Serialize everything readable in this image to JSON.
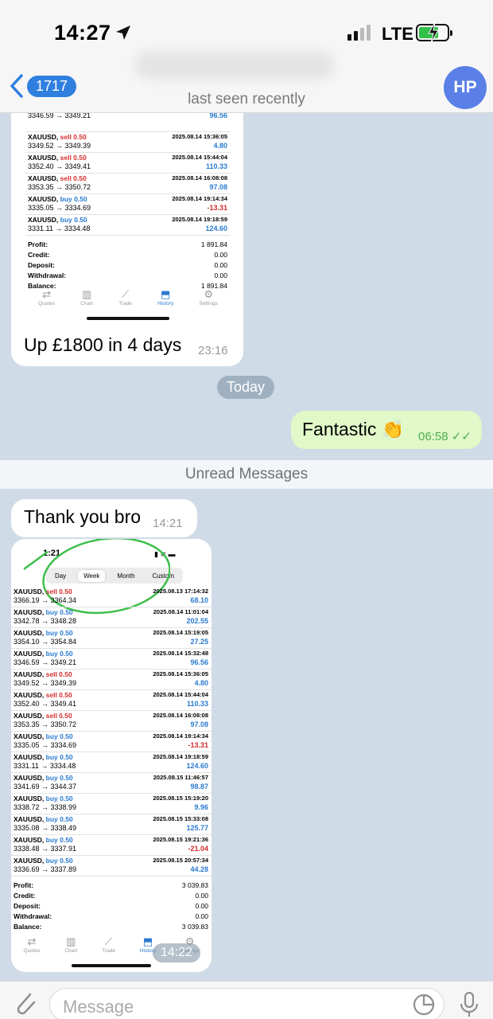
{
  "status_bar": {
    "time": "14:27",
    "network": "LTE"
  },
  "header": {
    "back_count": "1717",
    "subtitle": "last seen recently",
    "avatar_initials": "HP"
  },
  "screenshot1": {
    "rows": [
      {
        "sym": "",
        "dir": "",
        "type": "",
        "date": "",
        "prices": "3346.59 → 3349.21",
        "pl": "96.56",
        "sign": "pos"
      },
      {
        "sym": "XAUUSD,",
        "dir": "sell 0.50",
        "type": "sell",
        "date": "2025.08.14 15:36:05",
        "prices": "3349.52 → 3349.39",
        "pl": "4.80",
        "sign": "pos"
      },
      {
        "sym": "XAUUSD,",
        "dir": "sell 0.50",
        "type": "sell",
        "date": "2025.08.14 15:44:04",
        "prices": "3352.40 → 3349.41",
        "pl": "110.33",
        "sign": "pos"
      },
      {
        "sym": "XAUUSD,",
        "dir": "sell 0.50",
        "type": "sell",
        "date": "2025.08.14 16:08:08",
        "prices": "3353.35 → 3350.72",
        "pl": "97.08",
        "sign": "pos"
      },
      {
        "sym": "XAUUSD,",
        "dir": "buy 0.50",
        "type": "buy",
        "date": "2025.08.14 19:14:34",
        "prices": "3335.05 → 3334.69",
        "pl": "-13.31",
        "sign": "neg"
      },
      {
        "sym": "XAUUSD,",
        "dir": "buy 0.50",
        "type": "buy",
        "date": "2025.08.14 19:18:59",
        "prices": "3331.11 → 3334.48",
        "pl": "124.60",
        "sign": "pos"
      }
    ],
    "summary": [
      {
        "label": "Profit:",
        "value": "1 891.84"
      },
      {
        "label": "Credit:",
        "value": "0.00"
      },
      {
        "label": "Deposit:",
        "value": "0.00"
      },
      {
        "label": "Withdrawal:",
        "value": "0.00"
      },
      {
        "label": "Balance:",
        "value": "1 891.84"
      }
    ],
    "tabs": [
      "Quotes",
      "Chart",
      "Trade",
      "History",
      "Settings"
    ]
  },
  "messages": {
    "m1": {
      "text": "Up £1800 in 4 days",
      "time": "23:16"
    },
    "date_pill": "Today",
    "m2": {
      "text": "Fantastic 👏",
      "time": "06:58"
    },
    "unread": "Unread Messages",
    "m3": {
      "text": "Thank you bro",
      "time": "14:21"
    },
    "m4_time": "14:22"
  },
  "screenshot2": {
    "status_time": "1:21",
    "segments": [
      "Day",
      "Week",
      "Month",
      "Custom"
    ],
    "selected_segment": "Week",
    "rows": [
      {
        "sym": "XAUUSD,",
        "dir": "sell 0.50",
        "type": "sell",
        "date": "2025.08.13 17:14:32",
        "prices": "3366.19 → 3364.34",
        "pl": "68.10",
        "sign": "pos"
      },
      {
        "sym": "XAUUSD,",
        "dir": "buy 0.50",
        "type": "buy",
        "date": "2025.08.14 11:01:04",
        "prices": "3342.78 → 3348.28",
        "pl": "202.55",
        "sign": "pos"
      },
      {
        "sym": "XAUUSD,",
        "dir": "buy 0.50",
        "type": "buy",
        "date": "2025.08.14 15:19:05",
        "prices": "3354.10 → 3354.84",
        "pl": "27.25",
        "sign": "pos"
      },
      {
        "sym": "XAUUSD,",
        "dir": "buy 0.50",
        "type": "buy",
        "date": "2025.08.14 15:32:48",
        "prices": "3346.59 → 3349.21",
        "pl": "96.56",
        "sign": "pos"
      },
      {
        "sym": "XAUUSD,",
        "dir": "sell 0.50",
        "type": "sell",
        "date": "2025.08.14 15:36:05",
        "prices": "3349.52 → 3349.39",
        "pl": "4.80",
        "sign": "pos"
      },
      {
        "sym": "XAUUSD,",
        "dir": "sell 0.50",
        "type": "sell",
        "date": "2025.08.14 15:44:04",
        "prices": "3352.40 → 3349.41",
        "pl": "110.33",
        "sign": "pos"
      },
      {
        "sym": "XAUUSD,",
        "dir": "sell 0.50",
        "type": "sell",
        "date": "2025.08.14 16:08:08",
        "prices": "3353.35 → 3350.72",
        "pl": "97.08",
        "sign": "pos"
      },
      {
        "sym": "XAUUSD,",
        "dir": "buy 0.50",
        "type": "buy",
        "date": "2025.08.14 19:14:34",
        "prices": "3335.05 → 3334.69",
        "pl": "-13.31",
        "sign": "neg"
      },
      {
        "sym": "XAUUSD,",
        "dir": "buy 0.50",
        "type": "buy",
        "date": "2025.08.14 19:18:59",
        "prices": "3331.11 → 3334.48",
        "pl": "124.60",
        "sign": "pos"
      },
      {
        "sym": "XAUUSD,",
        "dir": "buy 0.50",
        "type": "buy",
        "date": "2025.08.15 11:46:57",
        "prices": "3341.69 → 3344.37",
        "pl": "98.87",
        "sign": "pos"
      },
      {
        "sym": "XAUUSD,",
        "dir": "buy 0.50",
        "type": "buy",
        "date": "2025.08.15 15:19:20",
        "prices": "3338.72 → 3338.99",
        "pl": "9.96",
        "sign": "pos"
      },
      {
        "sym": "XAUUSD,",
        "dir": "buy 0.50",
        "type": "buy",
        "date": "2025.08.15 15:33:08",
        "prices": "3335.08 → 3338.49",
        "pl": "125.77",
        "sign": "pos"
      },
      {
        "sym": "XAUUSD,",
        "dir": "buy 0.50",
        "type": "buy",
        "date": "2025.08.15 19:21:36",
        "prices": "3338.48 → 3337.91",
        "pl": "-21.04",
        "sign": "neg"
      },
      {
        "sym": "XAUUSD,",
        "dir": "buy 0.50",
        "type": "buy",
        "date": "2025.08.15 20:57:34",
        "prices": "3336.69 → 3337.89",
        "pl": "44.28",
        "sign": "pos"
      }
    ],
    "summary": [
      {
        "label": "Profit:",
        "value": "3 039.83"
      },
      {
        "label": "Credit:",
        "value": "0.00"
      },
      {
        "label": "Deposit:",
        "value": "0.00"
      },
      {
        "label": "Withdrawal:",
        "value": "0.00"
      },
      {
        "label": "Balance:",
        "value": "3 039.83"
      }
    ],
    "tabs": [
      "Quotes",
      "Chart",
      "Trade",
      "History",
      "Settings"
    ]
  },
  "input": {
    "placeholder": "Message"
  },
  "colors": {
    "accent": "#2f7fdf",
    "outgoing_bubble": "#e1f8c9",
    "sell": "#d62d2d",
    "buy": "#2a7ad0",
    "circle_annotation": "#3cbf4a"
  }
}
